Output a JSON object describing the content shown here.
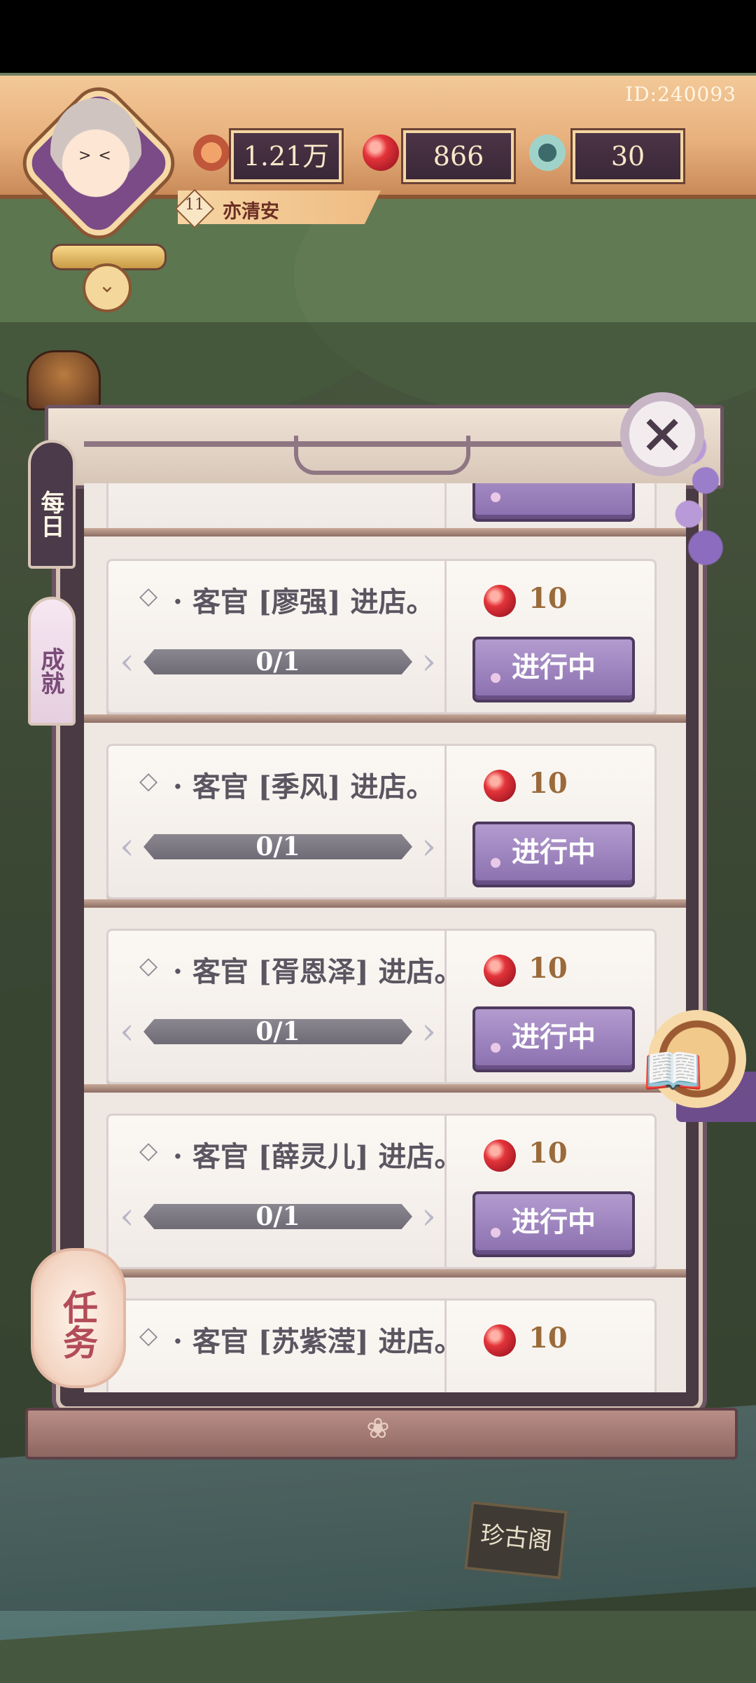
{
  "player": {
    "id_label": "ID:240093",
    "level": "11",
    "name": "亦清安"
  },
  "resources": {
    "copper": "1.21万",
    "gem": "866",
    "jade": "30"
  },
  "tabs": {
    "daily": "每日",
    "achievement": "成就"
  },
  "task_button_label": "任务",
  "shop_sign": "珍古阁",
  "quests": [
    {
      "text": "· 客官 [廖强] 进店。",
      "progress": "0/1",
      "progress_fraction": 0,
      "reward": "10",
      "status": "进行中"
    },
    {
      "text": "· 客官 [季风] 进店。",
      "progress": "0/1",
      "progress_fraction": 0,
      "reward": "10",
      "status": "进行中"
    },
    {
      "text": "· 客官 [胥恩泽] 进店。",
      "progress": "0/1",
      "progress_fraction": 0,
      "reward": "10",
      "status": "进行中"
    },
    {
      "text": "· 客官 [薛灵儿] 进店。",
      "progress": "0/1",
      "progress_fraction": 0,
      "reward": "10",
      "status": "进行中"
    },
    {
      "text": "· 客官 [苏紫滢] 进店。",
      "reward": "10"
    }
  ],
  "icons": {
    "quest": "diamond-quest-icon",
    "reward": "red-gem-icon",
    "close": "close-icon",
    "book": "book-icon"
  },
  "colors": {
    "status_button": "#9a7fbf",
    "reward_text": "#9a6a3a",
    "active_tab": "#4a3a4a"
  }
}
